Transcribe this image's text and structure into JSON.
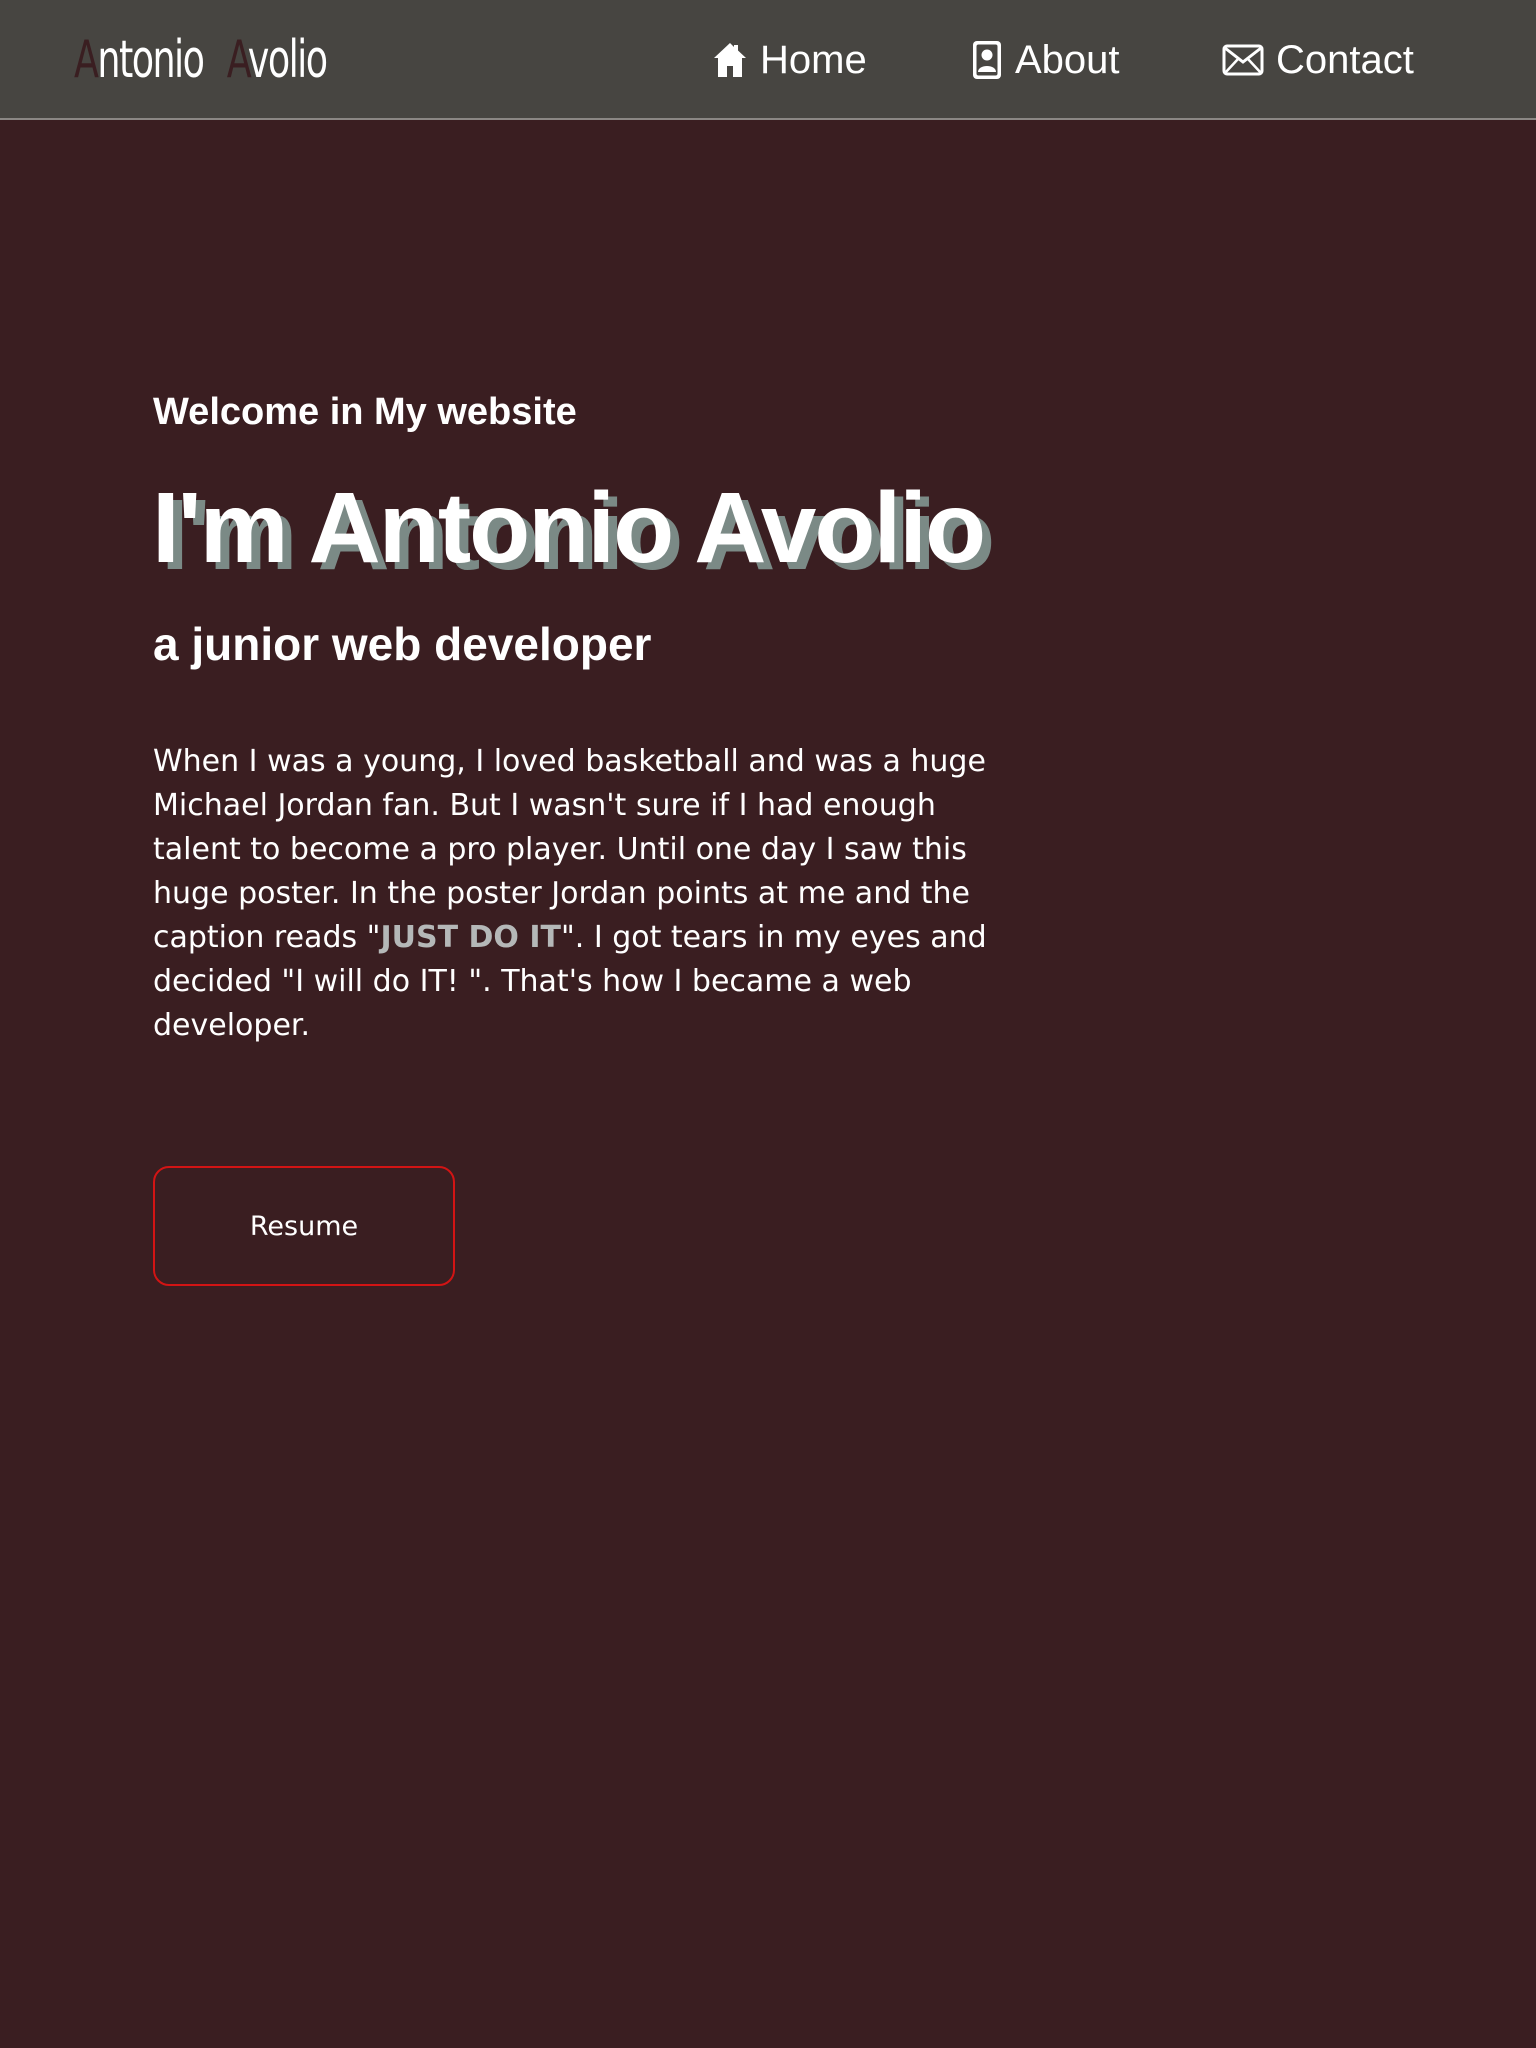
{
  "nav": {
    "logo": {
      "first_initial": "A",
      "first_rest": "ntonio",
      "last_initial": "A",
      "last_rest": "volio"
    },
    "links": [
      {
        "label": "Home",
        "icon": "home-icon"
      },
      {
        "label": "About",
        "icon": "person-badge-icon"
      },
      {
        "label": "Contact",
        "icon": "envelope-icon"
      }
    ]
  },
  "hero": {
    "welcome": "Welcome in My website",
    "name": "I'm Antonio Avolio",
    "role": "a junior web developer",
    "bio": {
      "before": "When I was a young, I loved basketball and was a huge Michael Jordan fan. But I wasn't sure if I had enough talent to become a pro player. Until one day I saw this huge poster. In the poster Jordan points at me and the caption reads \"",
      "highlight": "JUST DO IT",
      "after": "\". I got tears in my eyes and decided \"I will do IT! \". That's how I became a web developer."
    },
    "resume_label": "Resume"
  },
  "colors": {
    "background": "#3a1e21",
    "navbar": "#474541",
    "name_shadow": "#7b8a86",
    "highlight": "#b5b8b8",
    "button_border": "#d21414"
  }
}
